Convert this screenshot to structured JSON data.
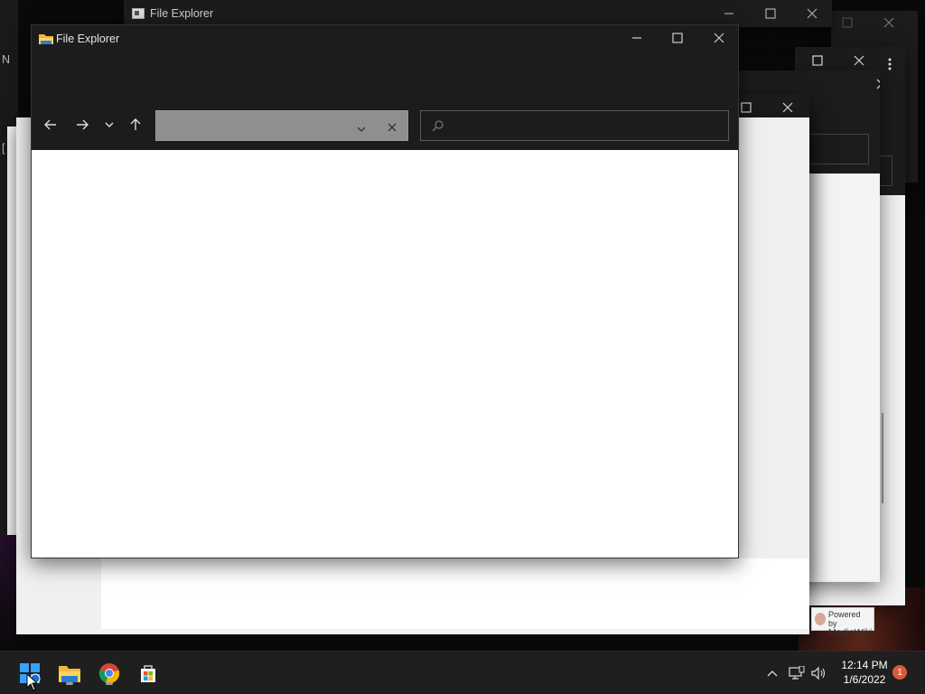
{
  "desktop": {
    "bg_windows": [
      {
        "title": "File Explorer"
      }
    ],
    "left_edge_glyphs": [
      "N",
      "["
    ]
  },
  "main_window": {
    "title": "File Explorer",
    "address": {
      "value": "",
      "placeholder": ""
    },
    "search": {
      "value": "",
      "placeholder": ""
    }
  },
  "mediawiki_badge": {
    "line1": "Powered by",
    "line2": "MediaWiki"
  },
  "taskbar": {
    "apps": [
      {
        "name": "start",
        "label": "Start"
      },
      {
        "name": "file-explorer",
        "label": "File Explorer"
      },
      {
        "name": "chrome",
        "label": "Google Chrome"
      },
      {
        "name": "store",
        "label": "Microsoft Store"
      }
    ],
    "clock": {
      "time": "12:14 PM",
      "date": "1/6/2022"
    },
    "notification_count": "1"
  },
  "colors": {
    "titlebar": "#1c1c1c",
    "address_bar": "#8f8f8f",
    "content": "#ffffff",
    "taskbar": "#1f1f1f",
    "badge": "#e0573a"
  }
}
